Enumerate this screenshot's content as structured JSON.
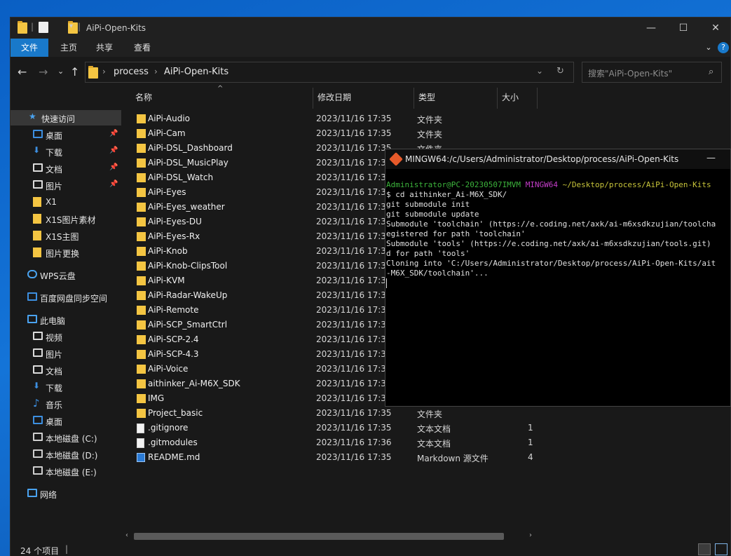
{
  "window": {
    "title": "AiPi-Open-Kits",
    "controls": {
      "minimize": "—",
      "maximize": "☐",
      "close": "✕"
    }
  },
  "ribbon": {
    "tabs": [
      "文件",
      "主页",
      "共享",
      "查看"
    ]
  },
  "nav": {
    "breadcrumbs": [
      "process",
      "AiPi-Open-Kits"
    ],
    "search_placeholder": "搜索\"AiPi-Open-Kits\""
  },
  "sidebar": {
    "items": [
      {
        "label": "快速访问",
        "icon": "star-icon",
        "pinned": false,
        "selected": true
      },
      {
        "label": "桌面",
        "icon": "desktop-icon",
        "pinned": true
      },
      {
        "label": "下载",
        "icon": "download-icon",
        "pinned": true
      },
      {
        "label": "文档",
        "icon": "document-icon",
        "pinned": true
      },
      {
        "label": "图片",
        "icon": "picture-icon",
        "pinned": true
      },
      {
        "label": "X1",
        "icon": "folder-icon",
        "pinned": false
      },
      {
        "label": "X1S图片素材",
        "icon": "folder-icon",
        "pinned": false
      },
      {
        "label": "X1S主图",
        "icon": "folder-icon",
        "pinned": false
      },
      {
        "label": "图片更换",
        "icon": "folder-icon",
        "pinned": false
      },
      {
        "label": "WPS云盘",
        "icon": "cloud-icon",
        "pinned": false
      },
      {
        "label": "百度网盘同步空间",
        "icon": "baidu-sync-icon",
        "pinned": false
      },
      {
        "label": "此电脑",
        "icon": "computer-icon",
        "pinned": false
      },
      {
        "label": "视频",
        "icon": "video-icon",
        "pinned": false
      },
      {
        "label": "图片",
        "icon": "picture-icon",
        "pinned": false
      },
      {
        "label": "文档",
        "icon": "document-icon",
        "pinned": false
      },
      {
        "label": "下载",
        "icon": "download-icon",
        "pinned": false
      },
      {
        "label": "音乐",
        "icon": "music-icon",
        "pinned": false
      },
      {
        "label": "桌面",
        "icon": "desktop-icon",
        "pinned": false
      },
      {
        "label": "本地磁盘 (C:)",
        "icon": "drive-icon",
        "pinned": false
      },
      {
        "label": "本地磁盘 (D:)",
        "icon": "drive-icon",
        "pinned": false
      },
      {
        "label": "本地磁盘 (E:)",
        "icon": "drive-icon",
        "pinned": false
      },
      {
        "label": "网络",
        "icon": "network-icon",
        "pinned": false
      }
    ]
  },
  "files": {
    "columns": [
      "名称",
      "修改日期",
      "类型",
      "大小"
    ],
    "rows": [
      {
        "name": "AiPi-Audio",
        "date": "2023/11/16 17:35",
        "type": "文件夹",
        "size": "",
        "kind": "folder"
      },
      {
        "name": "AiPi-Cam",
        "date": "2023/11/16 17:35",
        "type": "文件夹",
        "size": "",
        "kind": "folder"
      },
      {
        "name": "AiPi-DSL_Dashboard",
        "date": "2023/11/16 17:35",
        "type": "文件夹",
        "size": "",
        "kind": "folder"
      },
      {
        "name": "AiPi-DSL_MusicPlay",
        "date": "2023/11/16 17:35",
        "type": "",
        "size": "",
        "kind": "folder"
      },
      {
        "name": "AiPi-DSL_Watch",
        "date": "2023/11/16 17:35",
        "type": "",
        "size": "",
        "kind": "folder"
      },
      {
        "name": "AiPi-Eyes",
        "date": "2023/11/16 17:35",
        "type": "",
        "size": "",
        "kind": "folder"
      },
      {
        "name": "AiPi-Eyes_weather",
        "date": "2023/11/16 17:35",
        "type": "",
        "size": "",
        "kind": "folder"
      },
      {
        "name": "AiPi-Eyes-DU",
        "date": "2023/11/16 17:35",
        "type": "",
        "size": "",
        "kind": "folder"
      },
      {
        "name": "AiPi-Eyes-Rx",
        "date": "2023/11/16 17:35",
        "type": "",
        "size": "",
        "kind": "folder"
      },
      {
        "name": "AiPi-Knob",
        "date": "2023/11/16 17:35",
        "type": "",
        "size": "",
        "kind": "folder"
      },
      {
        "name": "AiPi-Knob-ClipsTool",
        "date": "2023/11/16 17:35",
        "type": "",
        "size": "",
        "kind": "folder"
      },
      {
        "name": "AiPi-KVM",
        "date": "2023/11/16 17:35",
        "type": "",
        "size": "",
        "kind": "folder"
      },
      {
        "name": "AiPi-Radar-WakeUp",
        "date": "2023/11/16 17:35",
        "type": "",
        "size": "",
        "kind": "folder"
      },
      {
        "name": "AiPi-Remote",
        "date": "2023/11/16 17:35",
        "type": "",
        "size": "",
        "kind": "folder"
      },
      {
        "name": "AiPi-SCP_SmartCtrl",
        "date": "2023/11/16 17:35",
        "type": "",
        "size": "",
        "kind": "folder"
      },
      {
        "name": "AiPi-SCP-2.4",
        "date": "2023/11/16 17:35",
        "type": "",
        "size": "",
        "kind": "folder"
      },
      {
        "name": "AiPi-SCP-4.3",
        "date": "2023/11/16 17:35",
        "type": "",
        "size": "",
        "kind": "folder"
      },
      {
        "name": "AiPi-Voice",
        "date": "2023/11/16 17:35",
        "type": "",
        "size": "",
        "kind": "folder"
      },
      {
        "name": "aithinker_Ai-M6X_SDK",
        "date": "2023/11/16 17:38",
        "type": "",
        "size": "",
        "kind": "folder"
      },
      {
        "name": "IMG",
        "date": "2023/11/16 17:35",
        "type": "",
        "size": "",
        "kind": "folder"
      },
      {
        "name": "Project_basic",
        "date": "2023/11/16 17:35",
        "type": "文件夹",
        "size": "",
        "kind": "folder"
      },
      {
        "name": ".gitignore",
        "date": "2023/11/16 17:35",
        "type": "文本文档",
        "size": "1",
        "kind": "text"
      },
      {
        "name": ".gitmodules",
        "date": "2023/11/16 17:36",
        "type": "文本文档",
        "size": "1",
        "kind": "text"
      },
      {
        "name": "README.md",
        "date": "2023/11/16 17:35",
        "type": "Markdown 源文件",
        "size": "4",
        "kind": "markdown"
      }
    ]
  },
  "status": {
    "item_count": "24 个项目"
  },
  "terminal": {
    "title": "MINGW64:/c/Users/Administrator/Desktop/process/AiPi-Open-Kits",
    "prompt_user": "Administrator@PC-20230507IMVM",
    "prompt_env": "MINGW64",
    "prompt_path": "~/Desktop/process/AiPi-Open-Kits",
    "lines": [
      "$ cd aithinker_Ai-M6X_SDK/",
      "git submodule init",
      "git submodule update",
      "Submodule 'toolchain' (https://e.coding.net/axk/ai-m6xsdkzujian/toolcha",
      "egistered for path 'toolchain'",
      "Submodule 'tools' (https://e.coding.net/axk/ai-m6xsdkzujian/tools.git)",
      "d for path 'tools'",
      "Cloning into 'C:/Users/Administrator/Desktop/process/AiPi-Open-Kits/ait",
      "-M6X_SDK/toolchain'..."
    ]
  },
  "colors": {
    "accent": "#1979ca",
    "folder": "#f4c542",
    "background": "#191919",
    "terminal_green": "#3cb43c",
    "terminal_magenta": "#c33dc8",
    "terminal_yellow": "#c7c43a"
  }
}
